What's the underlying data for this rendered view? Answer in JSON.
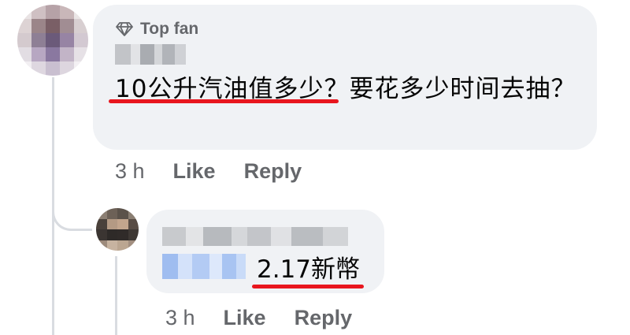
{
  "comment": {
    "badge_label": "Top fan",
    "badge_icon": "diamond-icon",
    "text": "10公升汽油值多少？要花多少时间去抽？",
    "time": "3 h",
    "like_label": "Like",
    "reply_label": "Reply"
  },
  "reply": {
    "text": "2.17新幣",
    "time": "3 h",
    "like_label": "Like",
    "reply_label": "Reply"
  },
  "colors": {
    "bubble": "#f0f2f5",
    "secondary_text": "#65676b",
    "highlight": "#e8161e",
    "mention": "#d6e4fb"
  }
}
